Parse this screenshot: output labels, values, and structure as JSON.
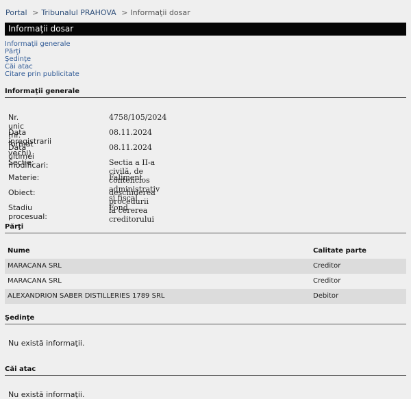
{
  "breadcrumb": {
    "portal": "Portal",
    "court": "Tribunalul PRAHOVA",
    "current": "Informaţii dosar",
    "separator": ">"
  },
  "title_bar": "Informaţii dosar",
  "anchors": [
    "Informaţii generale",
    "Părţi",
    "Şedinţe",
    "Căi atac",
    "Citare prin publicitate"
  ],
  "general": {
    "title": "Informaţii generale",
    "rows": [
      {
        "label": "Nr. unic (nr. format vechi) :",
        "value": "4758/105/2024"
      },
      {
        "label": "Data inregistrarii",
        "value": "08.11.2024"
      },
      {
        "label": "Data ultimei modificari:",
        "value": "08.11.2024"
      },
      {
        "label": "Sectie:",
        "value": "Sectia a II-a civilă, de contencios administrativ si fiscal"
      },
      {
        "label": "Materie:",
        "value": "Faliment"
      },
      {
        "label": "Obiect:",
        "value": "deschiderea procedurii la cererea creditorului"
      },
      {
        "label": "Stadiu procesual:",
        "value": "Fond"
      }
    ]
  },
  "parti": {
    "title": "Părţi",
    "headers": {
      "name": "Nume",
      "role": "Calitate parte"
    },
    "rows": [
      {
        "name": "MARACANA SRL",
        "role": "Creditor"
      },
      {
        "name": "MARACANA SRL",
        "role": "Creditor"
      },
      {
        "name": "ALEXANDRION SABER DISTILLERIES 1789 SRL",
        "role": "Debitor"
      }
    ]
  },
  "sedinte": {
    "title": "Şedinţe",
    "empty": "Nu există informaţii."
  },
  "cai_atac": {
    "title": "Căi atac",
    "empty": "Nu există informaţii."
  }
}
